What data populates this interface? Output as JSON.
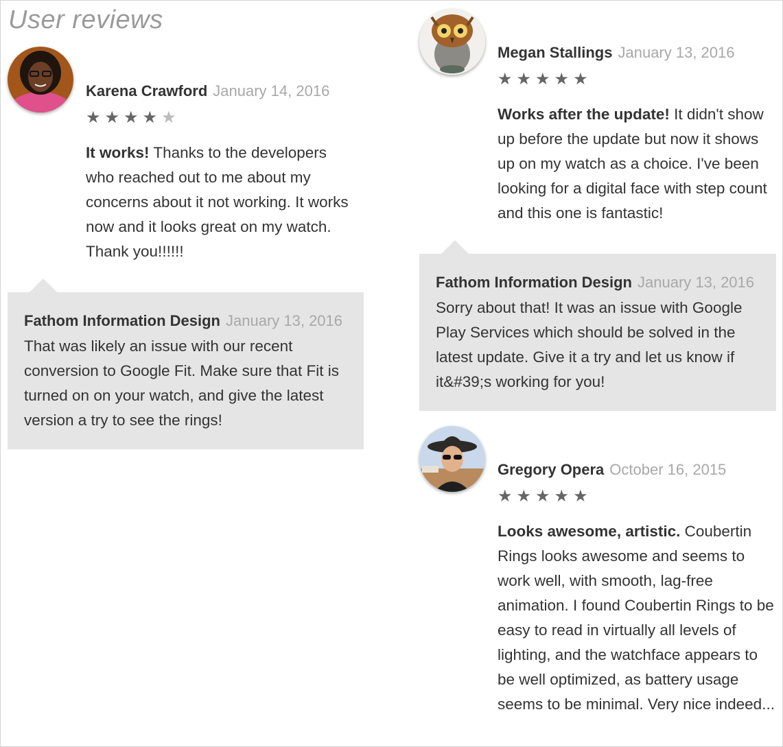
{
  "section_title": "User reviews",
  "reviews": [
    {
      "author": "Karena Crawford",
      "date": "January 14, 2016",
      "rating": 4,
      "headline": "It works!",
      "text": " Thanks to the developers who reached out to me about my concerns about it not working. It works now and it looks great on my watch. Thank you!!!!!!",
      "reply": {
        "author": "Fathom Information Design",
        "date": "January 13, 2016",
        "text": "That was likely an issue with our recent conversion to Google Fit. Make sure that Fit is turned on on your watch, and give the latest version a try to see the rings!"
      }
    },
    {
      "author": "Megan Stallings",
      "date": "January 13, 2016",
      "rating": 5,
      "headline": "Works after the update!",
      "text": " It didn't show up before the update but now it shows up on my watch as a choice. I've been looking for a digital face with step count and this one is fantastic!",
      "reply": {
        "author": "Fathom Information Design",
        "date": "January 13, 2016",
        "text": "Sorry about that! It was an issue with Google Play Services which should be solved in the latest update. Give it a try and let us know if it&#39;s working for you!"
      }
    },
    {
      "author": "Gregory Opera",
      "date": "October 16, 2015",
      "rating": 5,
      "headline": "Looks awesome, artistic.",
      "text": " Coubertin Rings looks awesome and seems to work well, with smooth, lag-free animation. I found Coubertin Rings to be easy to read in virtually all levels of lighting, and the watchface appears to be well optimized, as battery usage seems to be minimal. Very nice indeed..."
    }
  ],
  "star_glyph": "★",
  "colors": {
    "star_filled": "#666666",
    "star_empty": "#bbbbbb",
    "reply_bg": "#e5e5e5",
    "date": "#a8a8a8"
  }
}
